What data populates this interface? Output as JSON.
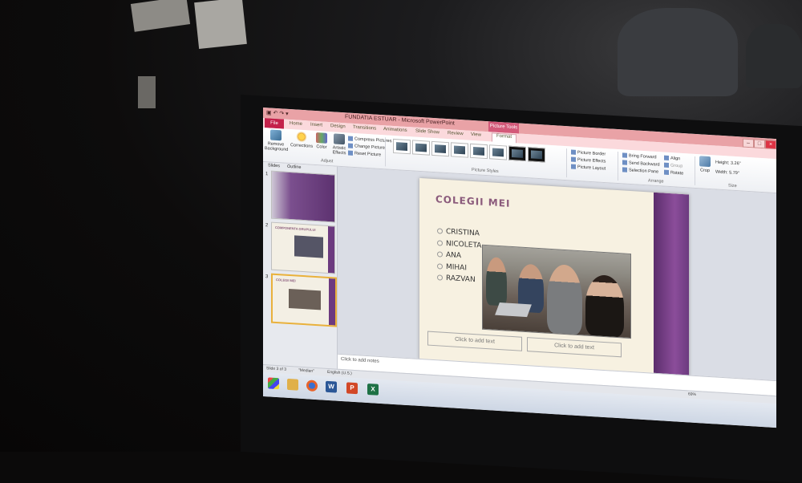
{
  "window": {
    "title": "FUNDATIA ESTUAR - Microsoft PowerPoint",
    "context_tab": "Picture Tools",
    "controls": [
      "–",
      "□",
      "×"
    ]
  },
  "ribbon_tabs": [
    "File",
    "Home",
    "Insert",
    "Design",
    "Transitions",
    "Animations",
    "Slide Show",
    "Review",
    "View",
    "Format"
  ],
  "ribbon": {
    "remove_background": "Remove Background",
    "corrections": "Corrections",
    "color": "Color",
    "artistic_effects": "Artistic Effects",
    "compress_pictures": "Compress Pictures",
    "change_picture": "Change Picture",
    "reset_picture": "Reset Picture",
    "adjust_group": "Adjust",
    "picture_styles_group": "Picture Styles",
    "picture_border": "Picture Border",
    "picture_effects": "Picture Effects",
    "picture_layout": "Picture Layout",
    "bring_forward": "Bring Forward",
    "send_backward": "Send Backward",
    "selection_pane": "Selection Pane",
    "align": "Align",
    "group": "Group",
    "rotate": "Rotate",
    "arrange_group": "Arrange",
    "crop": "Crop",
    "height_label": "Height:",
    "height_value": "3.26\"",
    "width_label": "Width:",
    "width_value": "5.79\"",
    "size_group": "Size"
  },
  "panel": {
    "tab_slides": "Slides",
    "tab_outline": "Outline",
    "slides": [
      {
        "num": "1"
      },
      {
        "num": "2",
        "title": "COMPONENTA GRUPULUI"
      },
      {
        "num": "3",
        "title": "COLEGII MEI"
      }
    ]
  },
  "slide": {
    "title": "COLEGII MEI",
    "bullets": [
      "CRISTINA",
      "NICOLETA",
      "ANA",
      "MIHAI",
      "RAZVAN"
    ],
    "placeholder_left": "Click to add text",
    "placeholder_right": "Click to add text"
  },
  "notes_placeholder": "Click to add notes",
  "status": {
    "slide_of": "Slide 3 of 3",
    "theme": "\"Median\"",
    "language": "English (U.S.)",
    "zoom": "69%"
  },
  "taskbar": {
    "icons": [
      "windows-start",
      "file-explorer",
      "firefox",
      "word",
      "powerpoint",
      "excel"
    ]
  },
  "colors": {
    "title_bar": "#e9a2a6",
    "file_tab": "#c4224b",
    "slide_band": "#6c3a7f",
    "slide_title": "#8b5b7c"
  }
}
